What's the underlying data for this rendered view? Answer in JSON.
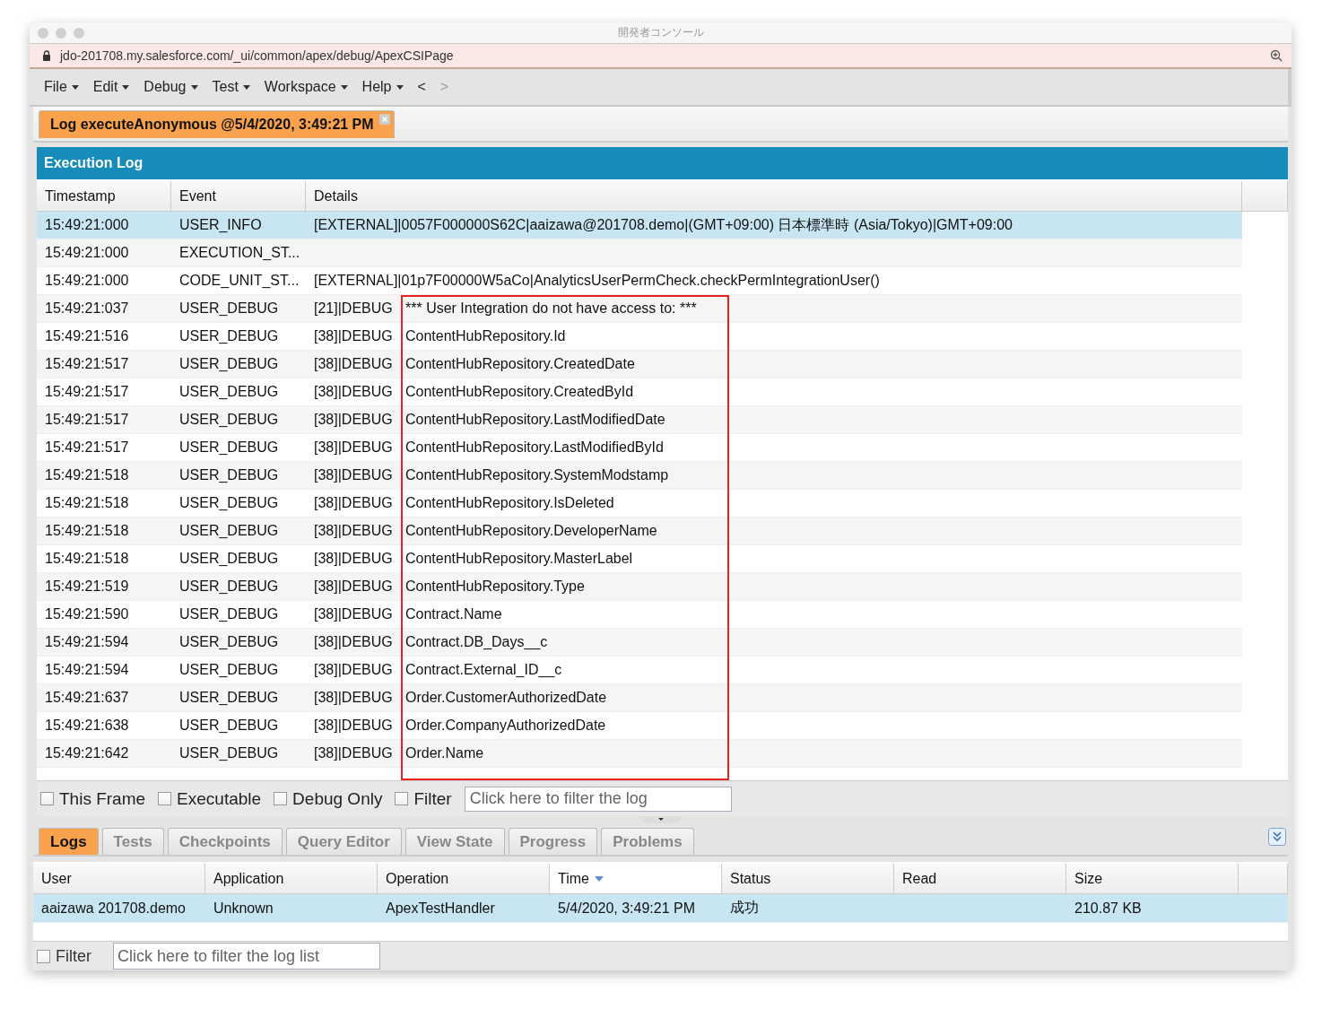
{
  "window": {
    "title": "開発者コンソール",
    "url": "jdo-201708.my.salesforce.com/_ui/common/apex/debug/ApexCSIPage"
  },
  "menu": [
    {
      "label": "File"
    },
    {
      "label": "Edit"
    },
    {
      "label": "Debug"
    },
    {
      "label": "Test"
    },
    {
      "label": "Workspace"
    },
    {
      "label": "Help"
    }
  ],
  "nav": [
    {
      "label": "<",
      "disabled": false
    },
    {
      "label": ">",
      "disabled": true
    }
  ],
  "editor_tabs": [
    {
      "label": "Log executeAnonymous @5/4/2020, 3:49:21 PM",
      "selected": true
    }
  ],
  "execution_log": {
    "title": "Execution Log",
    "columns": [
      "Timestamp",
      "Event",
      "Details"
    ],
    "rows": [
      {
        "timestamp": "15:49:21:000",
        "event": "USER_INFO",
        "details": "[EXTERNAL]|0057F000000S62C|aaizawa@201708.demo|(GMT+09:00) 日本標準時 (Asia/Tokyo)|GMT+09:00",
        "selected": true
      },
      {
        "timestamp": "15:49:21:000",
        "event": "EXECUTION_ST...",
        "details": "",
        "selected": false
      },
      {
        "timestamp": "15:49:21:000",
        "event": "CODE_UNIT_ST...",
        "details": "[EXTERNAL]|01p7F00000W5aCo|AnalyticsUserPermCheck.checkPermIntegrationUser()",
        "selected": false
      },
      {
        "timestamp": "15:49:21:037",
        "event": "USER_DEBUG",
        "details": "[21]|DEBUG",
        "message": "*** User Integration do not have access to: ***",
        "selected": false
      },
      {
        "timestamp": "15:49:21:516",
        "event": "USER_DEBUG",
        "details": "[38]|DEBUG",
        "message": "ContentHubRepository.Id",
        "selected": false
      },
      {
        "timestamp": "15:49:21:517",
        "event": "USER_DEBUG",
        "details": "[38]|DEBUG",
        "message": "ContentHubRepository.CreatedDate",
        "selected": false
      },
      {
        "timestamp": "15:49:21:517",
        "event": "USER_DEBUG",
        "details": "[38]|DEBUG",
        "message": "ContentHubRepository.CreatedById",
        "selected": false
      },
      {
        "timestamp": "15:49:21:517",
        "event": "USER_DEBUG",
        "details": "[38]|DEBUG",
        "message": "ContentHubRepository.LastModifiedDate",
        "selected": false
      },
      {
        "timestamp": "15:49:21:517",
        "event": "USER_DEBUG",
        "details": "[38]|DEBUG",
        "message": "ContentHubRepository.LastModifiedById",
        "selected": false
      },
      {
        "timestamp": "15:49:21:518",
        "event": "USER_DEBUG",
        "details": "[38]|DEBUG",
        "message": "ContentHubRepository.SystemModstamp",
        "selected": false
      },
      {
        "timestamp": "15:49:21:518",
        "event": "USER_DEBUG",
        "details": "[38]|DEBUG",
        "message": "ContentHubRepository.IsDeleted",
        "selected": false
      },
      {
        "timestamp": "15:49:21:518",
        "event": "USER_DEBUG",
        "details": "[38]|DEBUG",
        "message": "ContentHubRepository.DeveloperName",
        "selected": false
      },
      {
        "timestamp": "15:49:21:518",
        "event": "USER_DEBUG",
        "details": "[38]|DEBUG",
        "message": "ContentHubRepository.MasterLabel",
        "selected": false
      },
      {
        "timestamp": "15:49:21:519",
        "event": "USER_DEBUG",
        "details": "[38]|DEBUG",
        "message": "ContentHubRepository.Type",
        "selected": false
      },
      {
        "timestamp": "15:49:21:590",
        "event": "USER_DEBUG",
        "details": "[38]|DEBUG",
        "message": "Contract.Name",
        "selected": false
      },
      {
        "timestamp": "15:49:21:594",
        "event": "USER_DEBUG",
        "details": "[38]|DEBUG",
        "message": "Contract.DB_Days__c",
        "selected": false
      },
      {
        "timestamp": "15:49:21:594",
        "event": "USER_DEBUG",
        "details": "[38]|DEBUG",
        "message": "Contract.External_ID__c",
        "selected": false
      },
      {
        "timestamp": "15:49:21:637",
        "event": "USER_DEBUG",
        "details": "[38]|DEBUG",
        "message": "Order.CustomerAuthorizedDate",
        "selected": false
      },
      {
        "timestamp": "15:49:21:638",
        "event": "USER_DEBUG",
        "details": "[38]|DEBUG",
        "message": "Order.CompanyAuthorizedDate",
        "selected": false
      },
      {
        "timestamp": "15:49:21:642",
        "event": "USER_DEBUG",
        "details": "[38]|DEBUG",
        "message": "Order.Name",
        "selected": false
      }
    ],
    "filters": [
      {
        "label": "This Frame",
        "checked": false
      },
      {
        "label": "Executable",
        "checked": false
      },
      {
        "label": "Debug Only",
        "checked": false
      },
      {
        "label": "Filter",
        "checked": false
      }
    ],
    "filter_field": {
      "placeholder": "Click here to filter the log"
    }
  },
  "bottom_tabs": [
    {
      "label": "Logs",
      "selected": true
    },
    {
      "label": "Tests",
      "selected": false
    },
    {
      "label": "Checkpoints",
      "selected": false
    },
    {
      "label": "Query Editor",
      "selected": false
    },
    {
      "label": "View State",
      "selected": false
    },
    {
      "label": "Progress",
      "selected": false
    },
    {
      "label": "Problems",
      "selected": false
    }
  ],
  "logs_table": {
    "columns": [
      {
        "label": "User",
        "sorted": false
      },
      {
        "label": "Application",
        "sorted": false
      },
      {
        "label": "Operation",
        "sorted": false
      },
      {
        "label": "Time",
        "sorted": true
      },
      {
        "label": "Status",
        "sorted": false
      },
      {
        "label": "Read",
        "sorted": false
      },
      {
        "label": "Size",
        "sorted": false
      }
    ],
    "rows": [
      {
        "cells": [
          "aaizawa 201708.demo",
          "Unknown",
          "ApexTestHandler",
          "5/4/2020, 3:49:21 PM",
          "成功",
          "",
          "210.87 KB"
        ],
        "selected": true
      }
    ],
    "filter": {
      "label": "Filter",
      "checked": false
    },
    "filter_field": {
      "placeholder": "Click here to filter the log list"
    }
  }
}
